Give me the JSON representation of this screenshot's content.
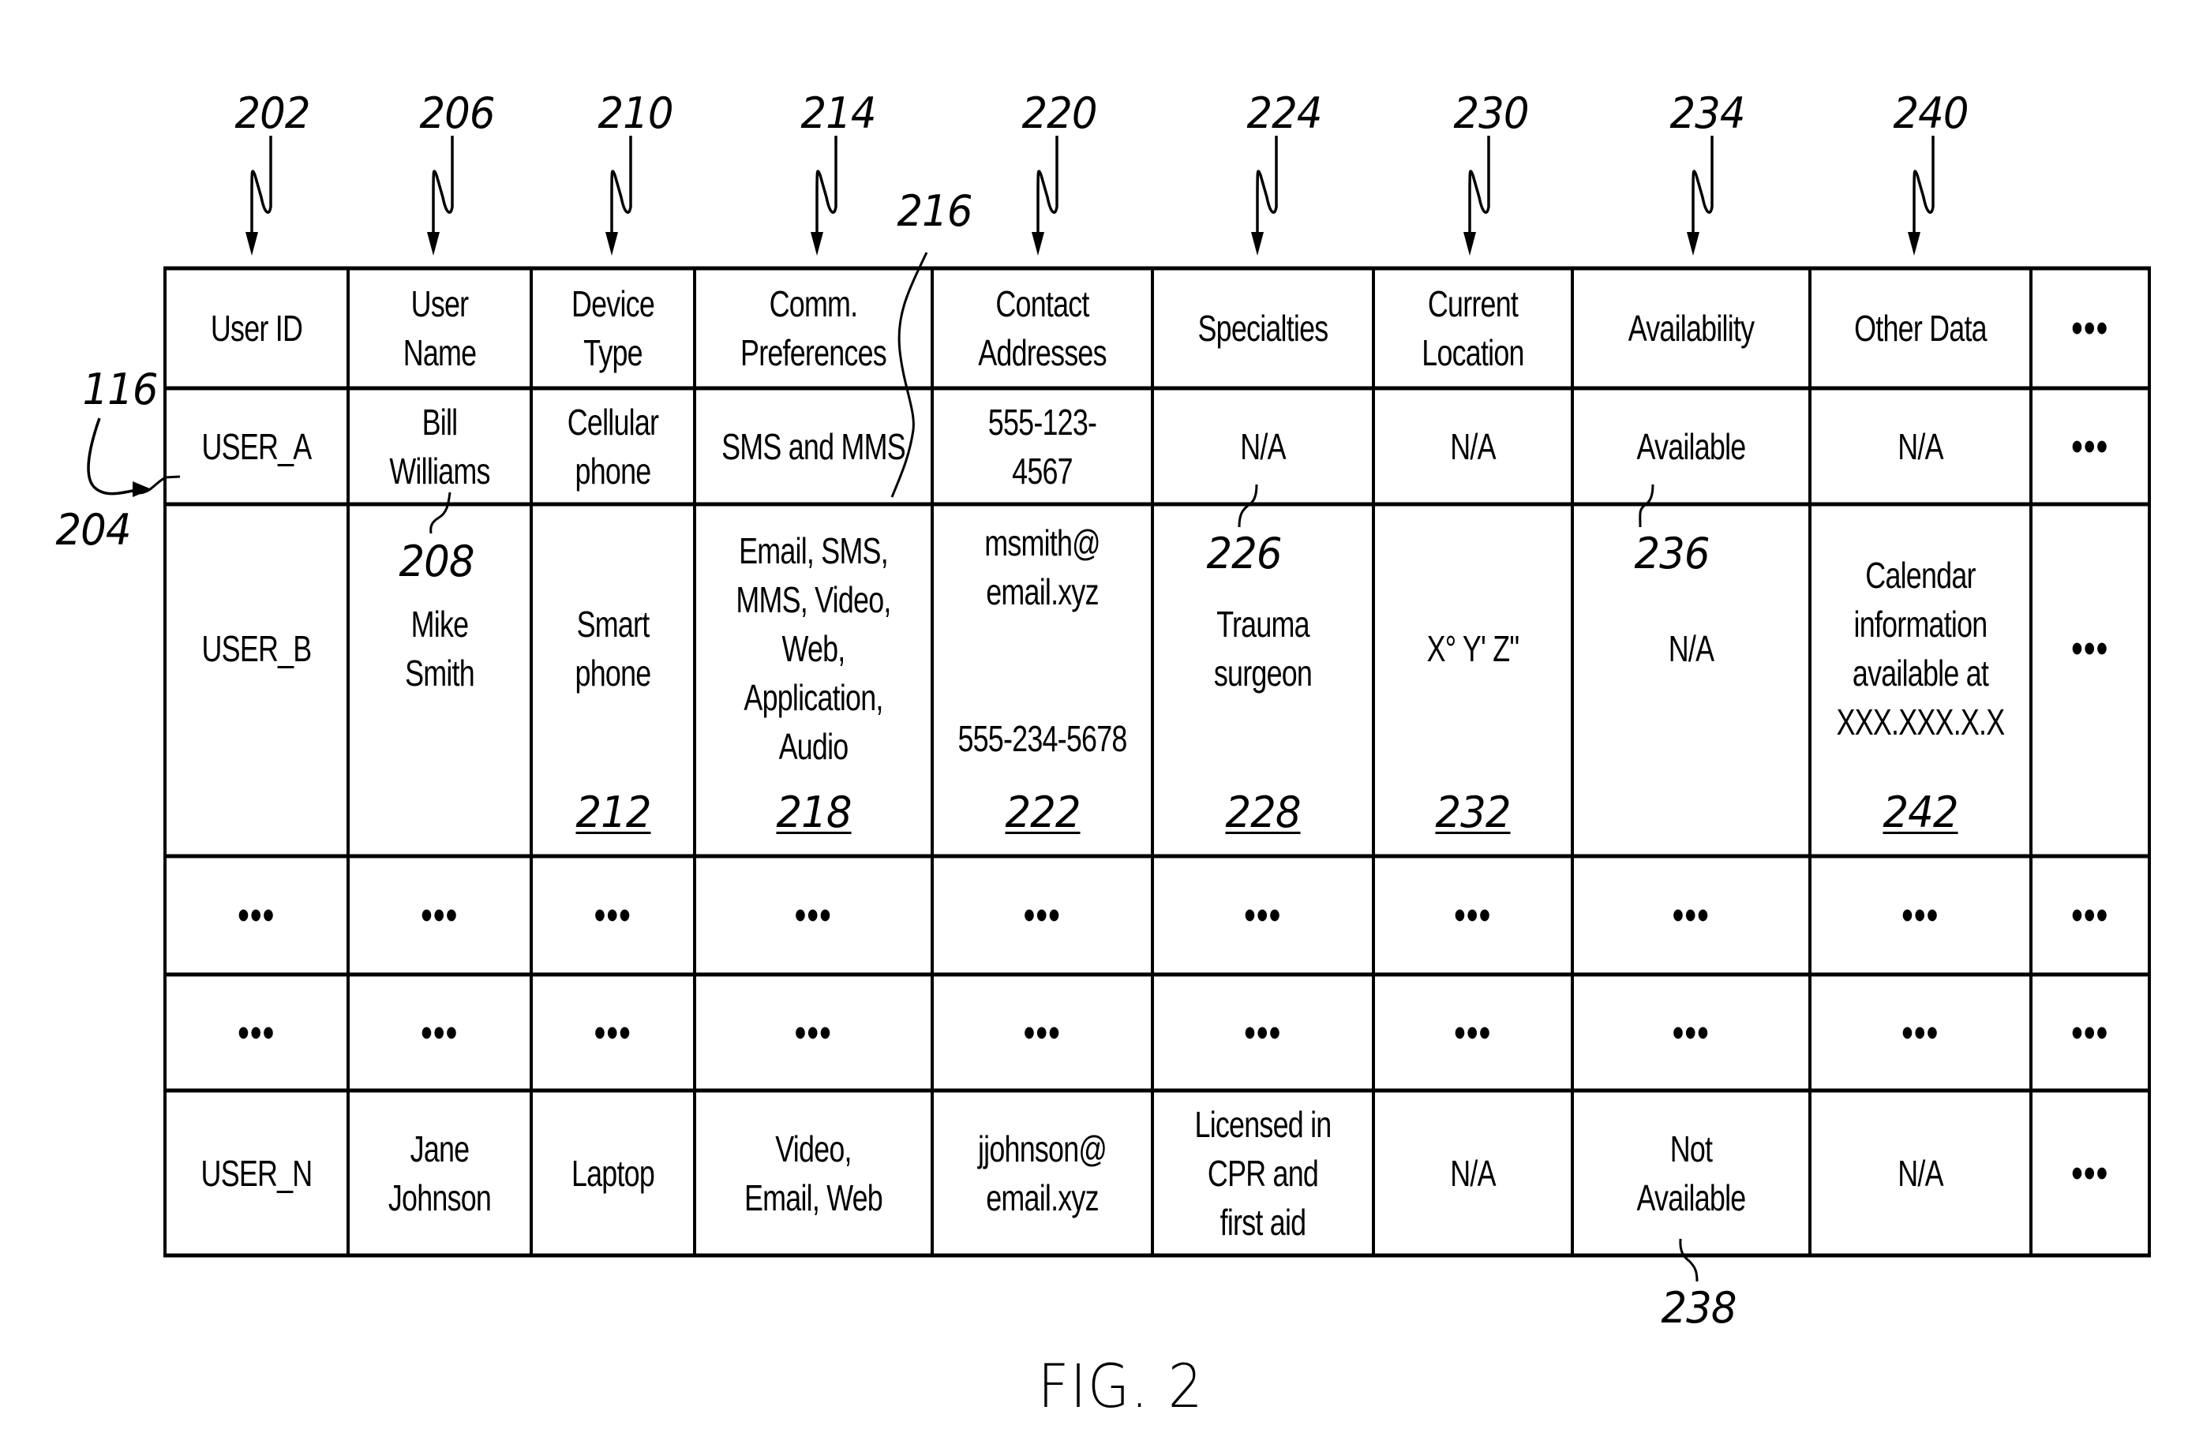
{
  "figure": {
    "caption": "FIG. 2",
    "table_ref": "116",
    "row_ref": "204"
  },
  "columns": [
    {
      "header": [
        "User ID"
      ],
      "ref": "202"
    },
    {
      "header": [
        "User",
        "Name"
      ],
      "ref": "206"
    },
    {
      "header": [
        "Device",
        "Type"
      ],
      "ref": "210"
    },
    {
      "header": [
        "Comm.",
        "Preferences"
      ],
      "ref": "214"
    },
    {
      "header": [
        "Contact",
        "Addresses"
      ],
      "ref": "220"
    },
    {
      "header": [
        "Specialties"
      ],
      "ref": "224"
    },
    {
      "header": [
        "Current",
        "Location"
      ],
      "ref": "230"
    },
    {
      "header": [
        "Availability"
      ],
      "ref": "234"
    },
    {
      "header": [
        "Other Data"
      ],
      "ref": "240"
    },
    {
      "header": [
        "•••"
      ],
      "ref": ""
    }
  ],
  "rows": [
    {
      "cells": [
        [
          "USER_A"
        ],
        [
          "Bill",
          "Williams"
        ],
        [
          "Cellular",
          "phone"
        ],
        [
          "SMS and MMS"
        ],
        [
          "555-123-",
          "4567"
        ],
        [
          "N/A"
        ],
        [
          "N/A"
        ],
        [
          "Available"
        ],
        [
          "N/A"
        ],
        [
          "•••"
        ]
      ]
    },
    {
      "cells": [
        [
          "USER_B"
        ],
        [
          "Mike",
          "Smith"
        ],
        [
          "Smart",
          "phone"
        ],
        [
          "Email, SMS,",
          "MMS, Video,",
          "Web,",
          "Application,",
          "Audio"
        ],
        [
          "msmith@",
          "email.xyz",
          "",
          "",
          "555-234-5678"
        ],
        [
          "Trauma",
          "surgeon"
        ],
        [
          "X° Y' Z\""
        ],
        [
          "N/A"
        ],
        [
          "Calendar",
          "information",
          "available at",
          "XXX.XXX.X.X"
        ],
        [
          "•••"
        ]
      ],
      "cell_refs": [
        "",
        "",
        "212",
        "218",
        "222",
        "228",
        "232",
        "",
        "242",
        ""
      ]
    },
    {
      "cells": [
        [
          "•••"
        ],
        [
          "•••"
        ],
        [
          "•••"
        ],
        [
          "•••"
        ],
        [
          "•••"
        ],
        [
          "•••"
        ],
        [
          "•••"
        ],
        [
          "•••"
        ],
        [
          "•••"
        ],
        [
          "•••"
        ]
      ]
    },
    {
      "cells": [
        [
          "•••"
        ],
        [
          "•••"
        ],
        [
          "•••"
        ],
        [
          "•••"
        ],
        [
          "•••"
        ],
        [
          "•••"
        ],
        [
          "•••"
        ],
        [
          "•••"
        ],
        [
          "•••"
        ],
        [
          "•••"
        ]
      ]
    },
    {
      "cells": [
        [
          "USER_N"
        ],
        [
          "Jane",
          "Johnson"
        ],
        [
          "Laptop"
        ],
        [
          "Video,",
          "Email, Web"
        ],
        [
          "jjohnson@",
          "email.xyz"
        ],
        [
          "Licensed in",
          "CPR and",
          "first aid"
        ],
        [
          "N/A"
        ],
        [
          "Not",
          "Available"
        ],
        [
          "N/A"
        ],
        [
          "•••"
        ]
      ]
    }
  ],
  "callouts": {
    "bill_williams": "208",
    "sms_and_mms": "216",
    "specialties_na": "226",
    "availability_available": "236",
    "availability_not_available": "238"
  }
}
